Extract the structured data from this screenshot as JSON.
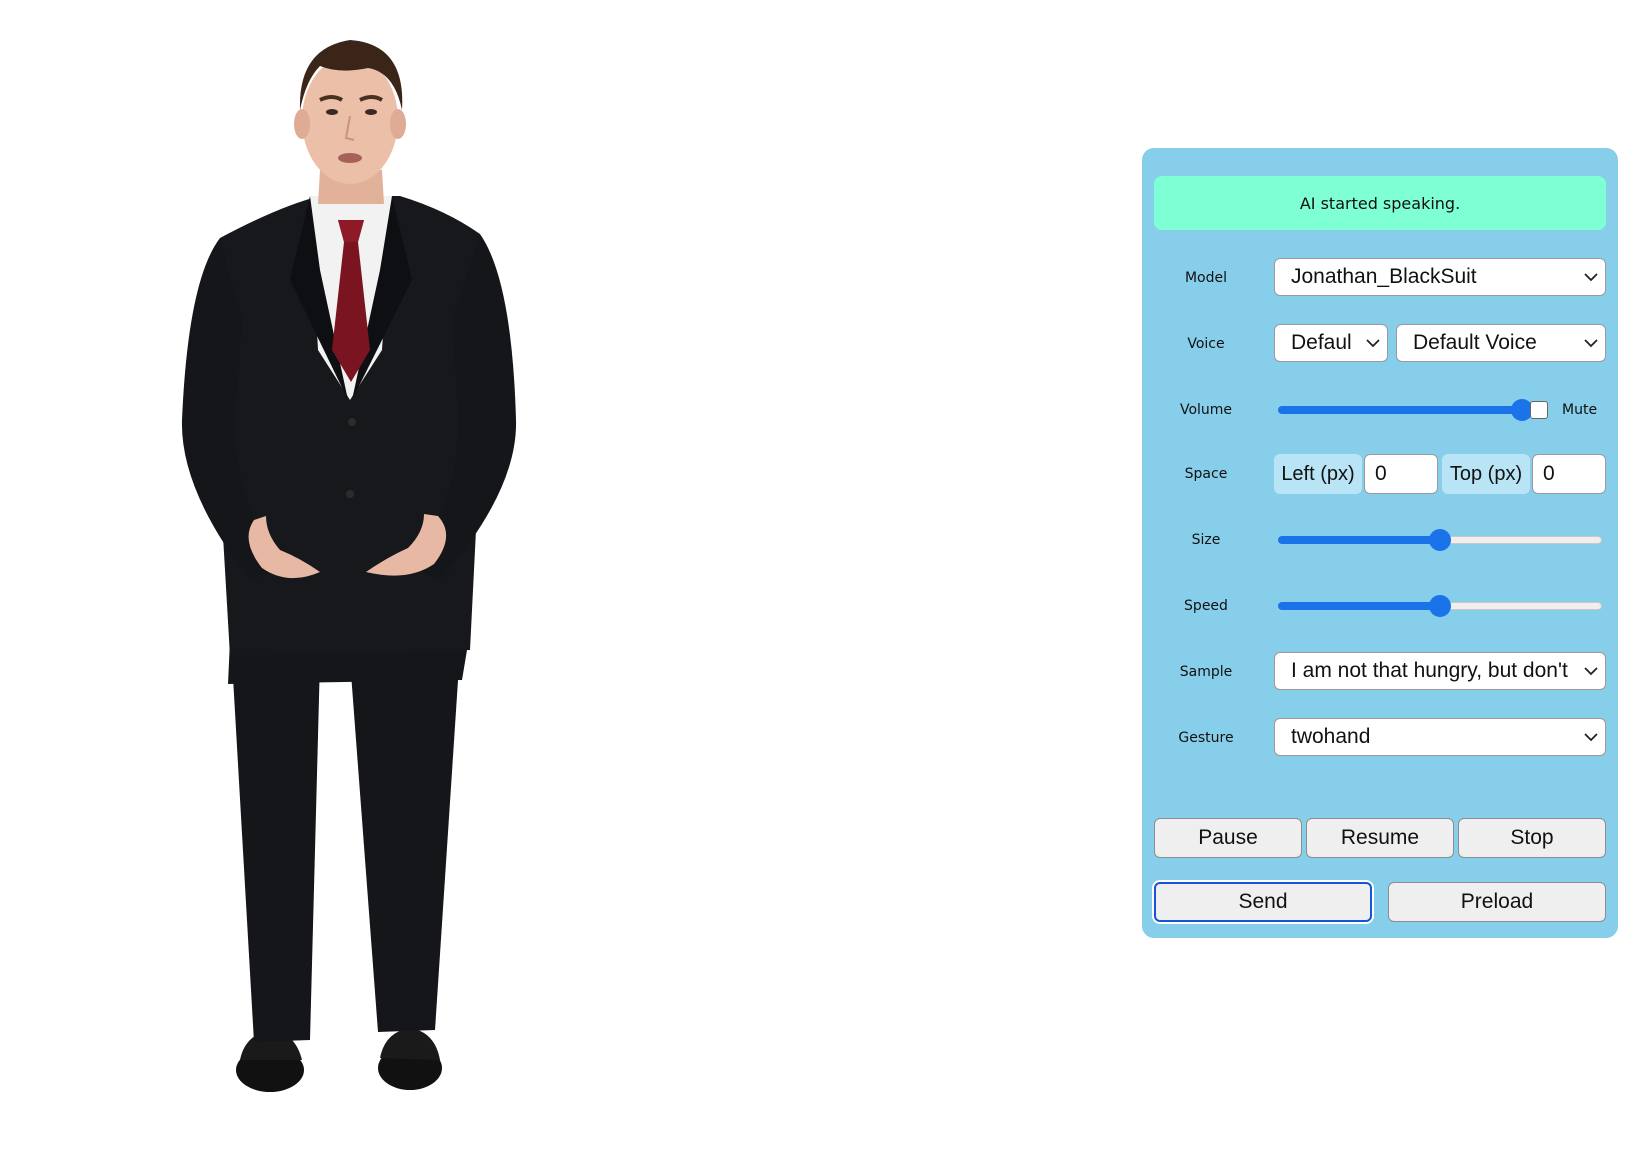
{
  "status": {
    "message": "AI started speaking."
  },
  "controls": {
    "model": {
      "label": "Model",
      "value": "Jonathan_BlackSuit"
    },
    "voice": {
      "label": "Voice",
      "language_value": "Defaul",
      "voice_value": "Default Voice"
    },
    "volume": {
      "label": "Volume",
      "level": 1.0,
      "mute_label": "Mute",
      "muted": false
    },
    "space": {
      "label": "Space",
      "left_tag": "Left (px)",
      "left_value": "0",
      "top_tag": "Top (px)",
      "top_value": "0"
    },
    "size": {
      "label": "Size",
      "level": 0.5
    },
    "speed": {
      "label": "Speed",
      "level": 0.5
    },
    "sample": {
      "label": "Sample",
      "value": "I am not that hungry, but don't"
    },
    "gesture": {
      "label": "Gesture",
      "value": "twohand"
    }
  },
  "buttons": {
    "pause": "Pause",
    "resume": "Resume",
    "stop": "Stop",
    "send": "Send",
    "preload": "Preload"
  },
  "colors": {
    "panel_bg": "#87ceeb",
    "status_bg": "#7fffd4",
    "slider_accent": "#1a73e8",
    "focus_ring": "#1256d6"
  }
}
